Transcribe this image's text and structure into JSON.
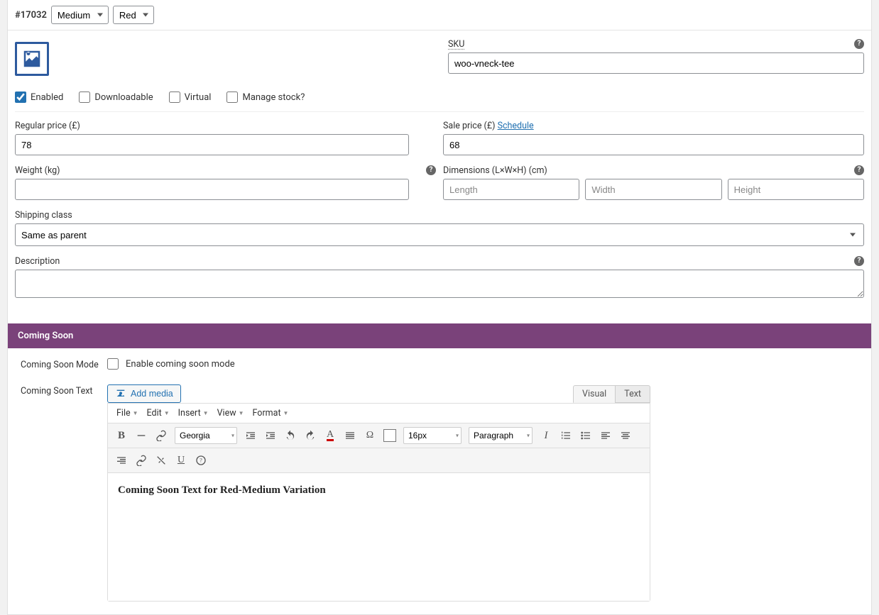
{
  "variation": {
    "id_prefix": "#17032",
    "size": "Medium",
    "color": "Red"
  },
  "sku": {
    "label": "SKU",
    "value": "woo-vneck-tee"
  },
  "options": {
    "enabled": "Enabled",
    "downloadable": "Downloadable",
    "virtual": "Virtual",
    "manage_stock": "Manage stock?"
  },
  "price": {
    "regular_label": "Regular price (£)",
    "regular": "78",
    "sale_label": "Sale price (£)",
    "sale": "68",
    "schedule": "Schedule"
  },
  "weight": {
    "label": "Weight (kg)",
    "value": ""
  },
  "dimensions": {
    "label": "Dimensions (L×W×H) (cm)",
    "length_ph": "Length",
    "width_ph": "Width",
    "height_ph": "Height"
  },
  "shipping": {
    "label": "Shipping class",
    "value": "Same as parent"
  },
  "description": {
    "label": "Description",
    "value": ""
  },
  "coming_soon": {
    "bar": "Coming Soon",
    "mode_label": "Coming Soon Mode",
    "mode_text": "Enable coming soon mode",
    "text_label": "Coming Soon Text",
    "add_media": "Add media"
  },
  "editor": {
    "menus": {
      "file": "File",
      "edit": "Edit",
      "insert": "Insert",
      "view": "View",
      "format": "Format"
    },
    "font": "Georgia",
    "size": "16px",
    "paragraph": "Paragraph",
    "tabs": {
      "visual": "Visual",
      "text": "Text"
    },
    "content": "Coming Soon Text for Red-Medium Variation"
  }
}
